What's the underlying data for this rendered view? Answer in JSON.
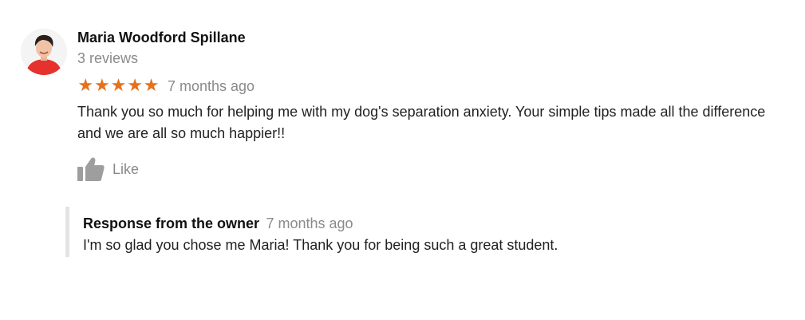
{
  "review": {
    "author_name": "Maria Woodford Spillane",
    "review_count": "3 reviews",
    "rating": 5,
    "stars": [
      "★",
      "★",
      "★",
      "★",
      "★"
    ],
    "time": "7 months ago",
    "text": "Thank you so much for helping me with my dog's separation anxiety. Your simple tips made all the difference and we are all so much happier!!",
    "like_label": "Like"
  },
  "owner_response": {
    "title": "Response from the owner",
    "time": "7 months ago",
    "text": "I'm so glad you chose me Maria! Thank you for being such a great student."
  },
  "colors": {
    "star": "#e7711b",
    "muted_text": "#8a8a8a",
    "body_text": "#222222",
    "response_border": "#e4e4e4",
    "like_icon": "#9e9e9e"
  },
  "icons": {
    "avatar": "profile-photo",
    "like": "thumbs-up-icon",
    "star": "star-icon"
  }
}
